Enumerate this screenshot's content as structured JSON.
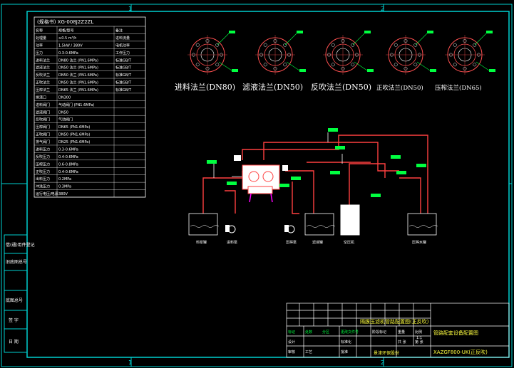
{
  "frame": {
    "zone_markers": [
      "1",
      "2",
      "1",
      "2"
    ]
  },
  "spec_table": {
    "title": "(规格书) XG-008J2Z2ZL",
    "rows": [
      [
        "名称",
        "规格/型号",
        "备注"
      ],
      [
        "处理量",
        "≥0.5 m³/h",
        "进料流量"
      ],
      [
        "功率",
        "1.5kW / 380V",
        "电机功率"
      ],
      [
        "压力",
        "0.3-0.6MPa",
        "工作压力"
      ],
      [
        "进料法兰",
        "DN80 法兰 (PN1.6MPa)",
        "标准GB/T"
      ],
      [
        "滤液法兰",
        "DN50 法兰 (PN1.6MPa)",
        "标准GB/T"
      ],
      [
        "反吹法兰",
        "DN50 法兰 (PN1.6MPa)",
        "标准GB/T"
      ],
      [
        "正吹法兰",
        "DN50 法兰 (PN1.6MPa)",
        "标准GB/T"
      ],
      [
        "压榨法兰",
        "DN65 法兰 (PN1.6MPa)",
        "标准GB/T"
      ],
      [
        "排渣口",
        "DN300",
        ""
      ],
      [
        "进料阀门",
        "气动阀门 (PN1.6MPa)",
        ""
      ],
      [
        "滤液阀门",
        "DN50",
        ""
      ],
      [
        "反吹阀门",
        "气动阀门",
        ""
      ],
      [
        "压榨阀门",
        "DN65 (PN1.6MPa)",
        ""
      ],
      [
        "正吹阀门",
        "DN50 (PN1.6MPa)",
        ""
      ],
      [
        "排气阀门",
        "DN25 (PN1.6MPa)",
        ""
      ],
      [
        "进料压力",
        "0.3-0.6MPa",
        ""
      ],
      [
        "反吹压力",
        "0.4-0.6MPa",
        ""
      ],
      [
        "压榨压力",
        "0.6-0.8MPa",
        ""
      ],
      [
        "正吹压力",
        "0.4-0.6MPa",
        ""
      ],
      [
        "出料压力",
        "0.2MPa",
        ""
      ],
      [
        "冲洗压力",
        "0.3MPa",
        ""
      ],
      [
        "运行电压/电源",
        "380V",
        ""
      ]
    ]
  },
  "left_side_labels": [
    "借(通)用件登记",
    "旧底图总号",
    "底图总号",
    "签 字",
    "日 期"
  ],
  "flanges": [
    {
      "label": "进料法兰(DN80)"
    },
    {
      "label": "滤液法兰(DN50)"
    },
    {
      "label": "反吹法兰(DN50)"
    },
    {
      "label": "正吹法兰(DN50)"
    },
    {
      "label": "压榨法兰(DN65)"
    }
  ],
  "tanks": [
    {
      "label": "料浆罐"
    },
    {
      "label": "滤液罐"
    },
    {
      "label": "空压机"
    },
    {
      "label": "压榨水罐"
    }
  ],
  "pumps": [
    {
      "label": "进料泵"
    },
    {
      "label": "压榨泵"
    }
  ],
  "title_block": {
    "drawing_desc": "隔膜压滤机管路配置图(正反吹)",
    "project": "管路配套设备配置图",
    "drawing_no": "XAZGF800-UK(正反吹)",
    "company": "景津环保股份",
    "cells": [
      "标记",
      "处数",
      "分区",
      "更改文件号",
      "签名",
      "年月日",
      "设计",
      "标准化",
      "阶段标记",
      "重量",
      "比例",
      "审核",
      "工艺",
      "批准",
      "共 张",
      "第 张"
    ],
    "scale": "1:1"
  },
  "colors": {
    "frame": "#00ffff",
    "pipe": "#ff4040",
    "pipe_white": "#ffffff",
    "callout": "#00ff40",
    "label_yellow": "#ffff40"
  }
}
